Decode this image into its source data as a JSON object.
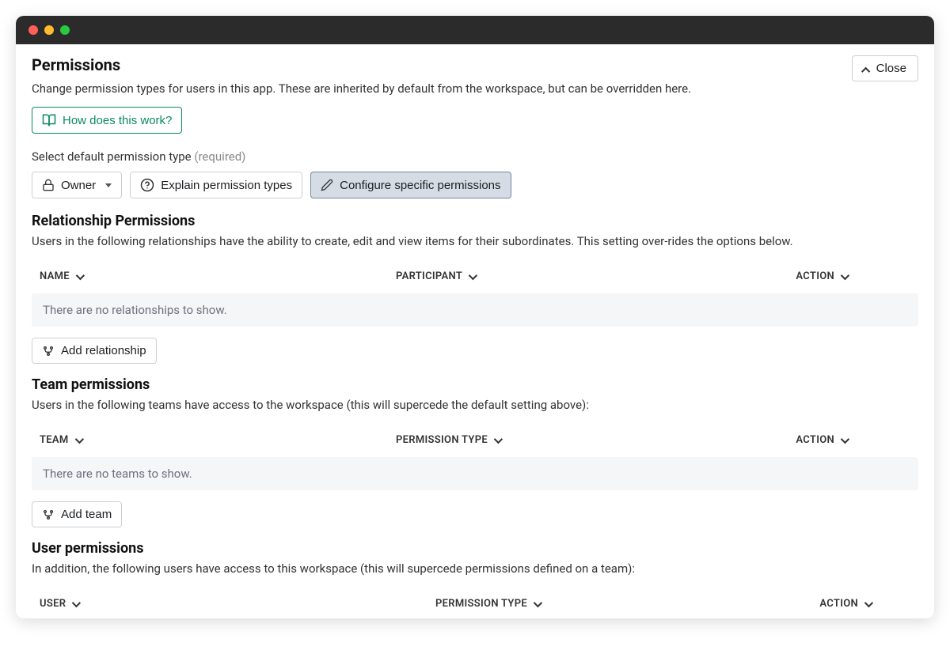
{
  "header": {
    "title": "Permissions",
    "description": "Change permission types for users in this app. These are inherited by default from the workspace, but can be overridden here.",
    "close_label": "Close",
    "help_label": "How does this work?"
  },
  "default_permission": {
    "label": "Select default permission type",
    "required_label": "(required)",
    "owner_label": "Owner",
    "explain_label": "Explain permission types",
    "configure_label": "Configure specific permissions"
  },
  "relationship": {
    "title": "Relationship Permissions",
    "description": "Users in the following relationships have the ability to create, edit and view items for their subordinates. This setting over-rides the options below.",
    "columns": {
      "name": "NAME",
      "participant": "PARTICIPANT",
      "action": "ACTION"
    },
    "empty": "There are no relationships to show.",
    "add_label": "Add relationship"
  },
  "team": {
    "title": "Team permissions",
    "description": "Users in the following teams have access to the workspace (this will supercede the default setting above):",
    "columns": {
      "team": "TEAM",
      "permission_type": "PERMISSION TYPE",
      "action": "ACTION"
    },
    "empty": "There are no teams to show.",
    "add_label": "Add team"
  },
  "user": {
    "title": "User permissions",
    "description": "In addition, the following users have access to this workspace (this will supercede permissions defined on a team):",
    "columns": {
      "user": "USER",
      "permission_type": "PERMISSION TYPE",
      "action": "ACTION"
    }
  }
}
